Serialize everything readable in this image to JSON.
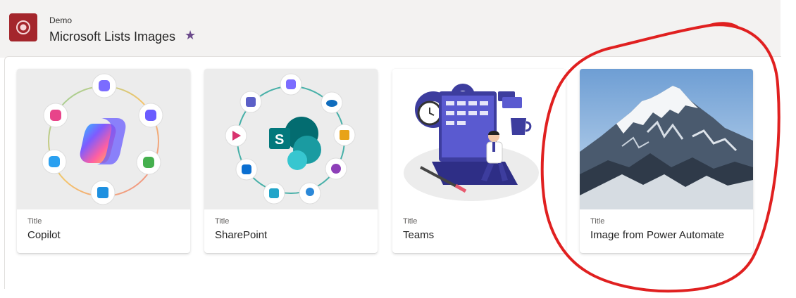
{
  "header": {
    "site_name": "Demo",
    "list_title": "Microsoft Lists Images",
    "favorite_icon": "star-icon",
    "app_icon": "lists-icon",
    "app_icon_color": "#a4262c",
    "star_color": "#6b4b8c"
  },
  "cards": [
    {
      "field_label": "Title",
      "title": "Copilot",
      "image": "copilot-logo-ring"
    },
    {
      "field_label": "Title",
      "title": "SharePoint",
      "image": "sharepoint-logo-ring"
    },
    {
      "field_label": "Title",
      "title": "Teams",
      "image": "laptop-person-illustration"
    },
    {
      "field_label": "Title",
      "title": "Image from Power Automate",
      "image": "snowy-mountain-photo"
    }
  ],
  "annotation": {
    "shape": "freehand-circle",
    "color": "#e02020",
    "target": "card-4"
  }
}
